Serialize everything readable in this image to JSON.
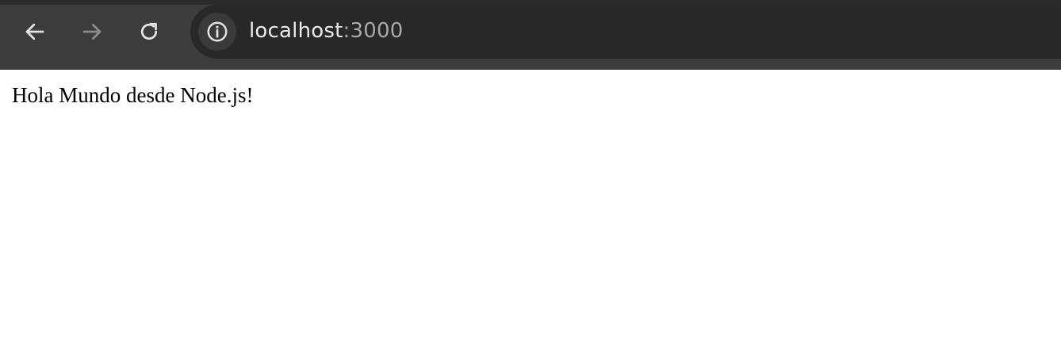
{
  "browser": {
    "url_host": "localhost",
    "url_port": ":3000",
    "icons": {
      "back": "arrow-left-icon",
      "forward": "arrow-right-icon",
      "reload": "reload-icon",
      "site_info": "info-icon"
    },
    "colors": {
      "toolbar": "#3c3c3c",
      "omnibox": "#282828",
      "icon_active": "#e3e3e3",
      "icon_disabled": "#8a8a8a"
    }
  },
  "page": {
    "body_text": "Hola Mundo desde Node.js!"
  }
}
